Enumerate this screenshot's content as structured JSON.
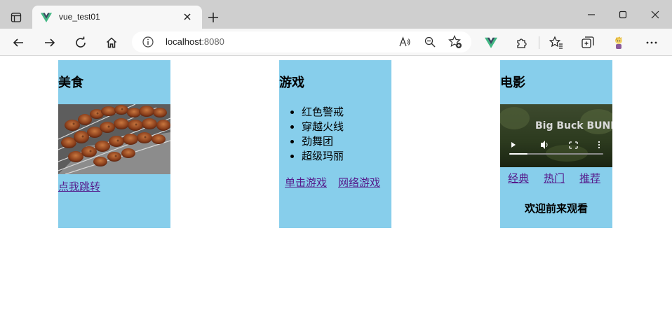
{
  "browser": {
    "tab": {
      "title": "vue_test01"
    },
    "address": {
      "host": "localhost",
      "port": ":8080"
    }
  },
  "cards": {
    "food": {
      "title": "美食",
      "link": "点我跳转"
    },
    "games": {
      "title": "游戏",
      "items": [
        "红色警戒",
        "穿越火线",
        "劲舞团",
        "超级玛丽"
      ],
      "links": [
        "单击游戏",
        "网络游戏"
      ]
    },
    "movies": {
      "title": "电影",
      "video_title": "Big Buck BUNNY",
      "links": [
        "经典",
        "热门",
        "推荐"
      ],
      "welcome": "欢迎前来观看"
    }
  },
  "colors": {
    "card_bg": "#87ceeb",
    "link": "#551a8b",
    "vue_green": "#41b883",
    "vue_dark": "#35495e"
  }
}
